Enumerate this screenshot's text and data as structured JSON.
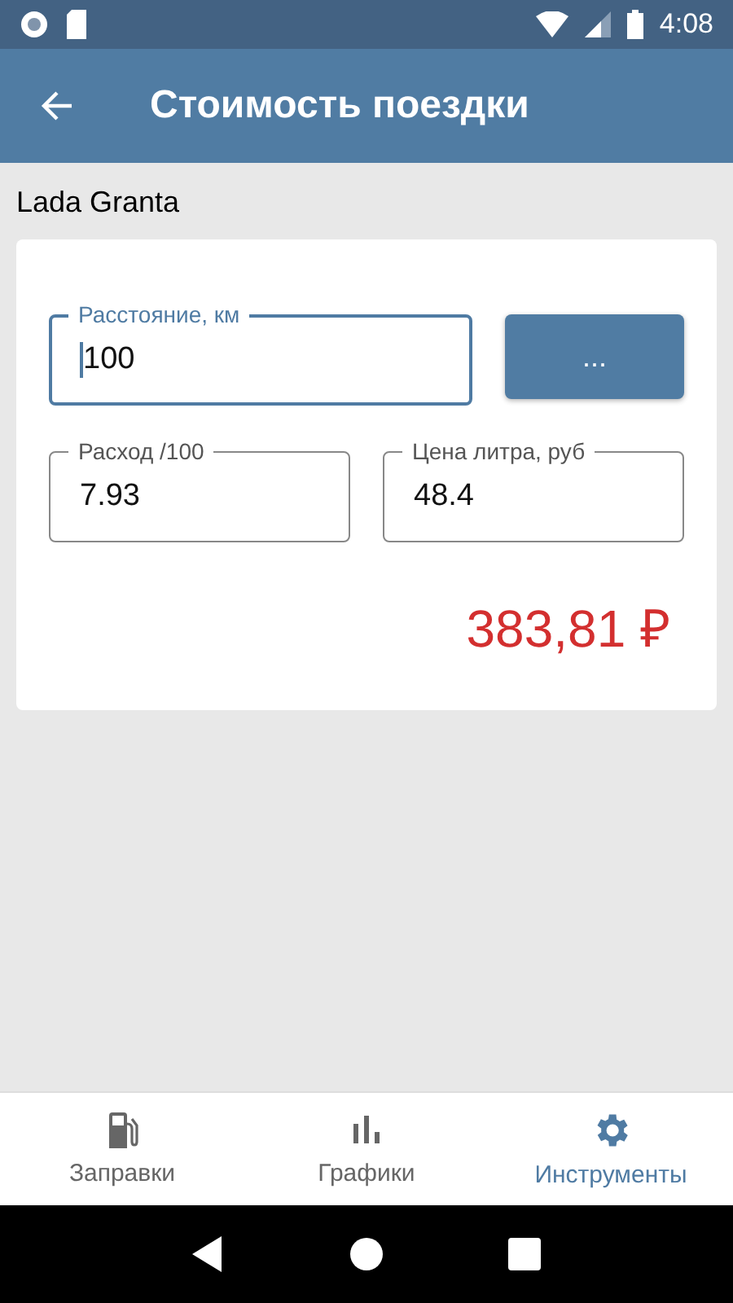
{
  "status_bar": {
    "time": "4:08"
  },
  "app_bar": {
    "title": "Стоимость поездки"
  },
  "car_name": "Lada Granta",
  "form": {
    "fields": [
      {
        "label": "Расстояние, км",
        "value": "100",
        "focused": true
      },
      {
        "label": "Расход /100",
        "value": "7.93",
        "focused": false
      },
      {
        "label": "Цена литра, руб",
        "value": "48.4",
        "focused": false
      }
    ],
    "more_button": "...",
    "result": "383,81 ₽"
  },
  "bottom_nav": [
    {
      "kind": "fuel",
      "label": "Заправки",
      "selected": false
    },
    {
      "kind": "chart",
      "label": "Графики",
      "selected": false
    },
    {
      "kind": "gear",
      "label": "Инструменты",
      "selected": true
    }
  ]
}
